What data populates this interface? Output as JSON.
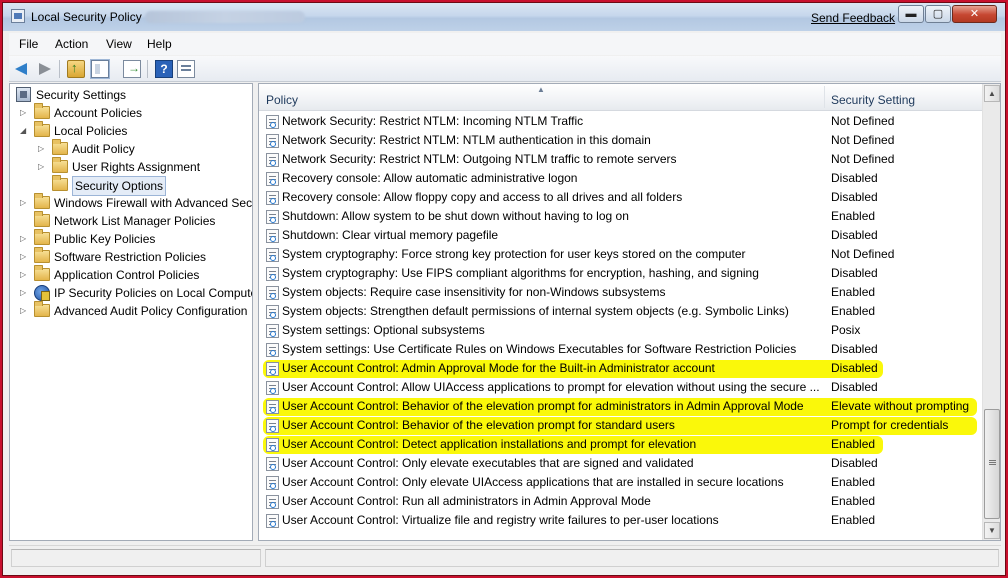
{
  "window": {
    "title": "Local Security Policy",
    "send_feedback": "Send Feedback",
    "minimize": "▬",
    "maximize": "▢",
    "close": "✕"
  },
  "menu": [
    "File",
    "Action",
    "View",
    "Help"
  ],
  "toolbar": {
    "help_glyph": "?"
  },
  "tree": [
    {
      "label": "Security Settings",
      "icon": "shield-icon",
      "arrow": "",
      "level": 0
    },
    {
      "label": "Account Policies",
      "icon": "folder-icon",
      "arrow": "▷",
      "level": 1
    },
    {
      "label": "Local Policies",
      "icon": "folder-icon",
      "arrow": "◢",
      "level": 1
    },
    {
      "label": "Audit Policy",
      "icon": "folder-icon",
      "arrow": "▷",
      "level": 2
    },
    {
      "label": "User Rights Assignment",
      "icon": "folder-icon",
      "arrow": "▷",
      "level": 2
    },
    {
      "label": "Security Options",
      "icon": "folder-icon",
      "arrow": "",
      "level": 2,
      "selected": true
    },
    {
      "label": "Windows Firewall with Advanced Secu",
      "icon": "folder-icon",
      "arrow": "▷",
      "level": 1
    },
    {
      "label": "Network List Manager Policies",
      "icon": "folder-icon",
      "arrow": "",
      "level": 1
    },
    {
      "label": "Public Key Policies",
      "icon": "folder-icon",
      "arrow": "▷",
      "level": 1
    },
    {
      "label": "Software Restriction Policies",
      "icon": "folder-icon",
      "arrow": "▷",
      "level": 1
    },
    {
      "label": "Application Control Policies",
      "icon": "folder-icon",
      "arrow": "▷",
      "level": 1
    },
    {
      "label": "IP Security Policies on Local Compute",
      "icon": "ipsec-icon",
      "arrow": "▷",
      "level": 1
    },
    {
      "label": "Advanced Audit Policy Configuration",
      "icon": "folder-icon",
      "arrow": "▷",
      "level": 1
    }
  ],
  "list": {
    "columns": {
      "policy": "Policy",
      "setting": "Security Setting"
    },
    "sort_arrow": "▲",
    "rows": [
      {
        "policy": "Network Security: Restrict NTLM: Incoming NTLM Traffic",
        "setting": "Not Defined"
      },
      {
        "policy": "Network Security: Restrict NTLM: NTLM authentication in this domain",
        "setting": "Not Defined"
      },
      {
        "policy": "Network Security: Restrict NTLM: Outgoing NTLM traffic to remote servers",
        "setting": "Not Defined"
      },
      {
        "policy": "Recovery console: Allow automatic administrative logon",
        "setting": "Disabled"
      },
      {
        "policy": "Recovery console: Allow floppy copy and access to all drives and all folders",
        "setting": "Disabled"
      },
      {
        "policy": "Shutdown: Allow system to be shut down without having to log on",
        "setting": "Enabled"
      },
      {
        "policy": "Shutdown: Clear virtual memory pagefile",
        "setting": "Disabled"
      },
      {
        "policy": "System cryptography: Force strong key protection for user keys stored on the computer",
        "setting": "Not Defined"
      },
      {
        "policy": "System cryptography: Use FIPS compliant algorithms for encryption, hashing, and signing",
        "setting": "Disabled"
      },
      {
        "policy": "System objects: Require case insensitivity for non-Windows subsystems",
        "setting": "Enabled"
      },
      {
        "policy": "System objects: Strengthen default permissions of internal system objects (e.g. Symbolic Links)",
        "setting": "Enabled"
      },
      {
        "policy": "System settings: Optional subsystems",
        "setting": "Posix"
      },
      {
        "policy": "System settings: Use Certificate Rules on Windows Executables for Software Restriction Policies",
        "setting": "Disabled"
      },
      {
        "policy": "User Account Control: Admin Approval Mode for the Built-in Administrator account",
        "setting": "Disabled",
        "highlighted": true
      },
      {
        "policy": "User Account Control: Allow UIAccess applications to prompt for elevation without using the secure ...",
        "setting": "Disabled"
      },
      {
        "policy": "User Account Control: Behavior of the elevation prompt for administrators in Admin Approval Mode",
        "setting": "Elevate without prompting",
        "highlighted": true
      },
      {
        "policy": "User Account Control: Behavior of the elevation prompt for standard users",
        "setting": "Prompt for credentials",
        "highlighted": true
      },
      {
        "policy": "User Account Control: Detect application installations and prompt for elevation",
        "setting": "Enabled",
        "highlighted": true
      },
      {
        "policy": "User Account Control: Only elevate executables that are signed and validated",
        "setting": "Disabled"
      },
      {
        "policy": "User Account Control: Only elevate UIAccess applications that are installed in secure locations",
        "setting": "Enabled"
      },
      {
        "policy": "User Account Control: Run all administrators in Admin Approval Mode",
        "setting": "Enabled"
      },
      {
        "policy": "User Account Control: Virtualize file and registry write failures to per-user locations",
        "setting": "Enabled"
      }
    ]
  },
  "scrollbar": {
    "up": "▲",
    "down": "▼"
  },
  "colors": {
    "highlight": "#faf80a",
    "frame": "#c8102e",
    "tree_selected": "#e4ecf7"
  }
}
